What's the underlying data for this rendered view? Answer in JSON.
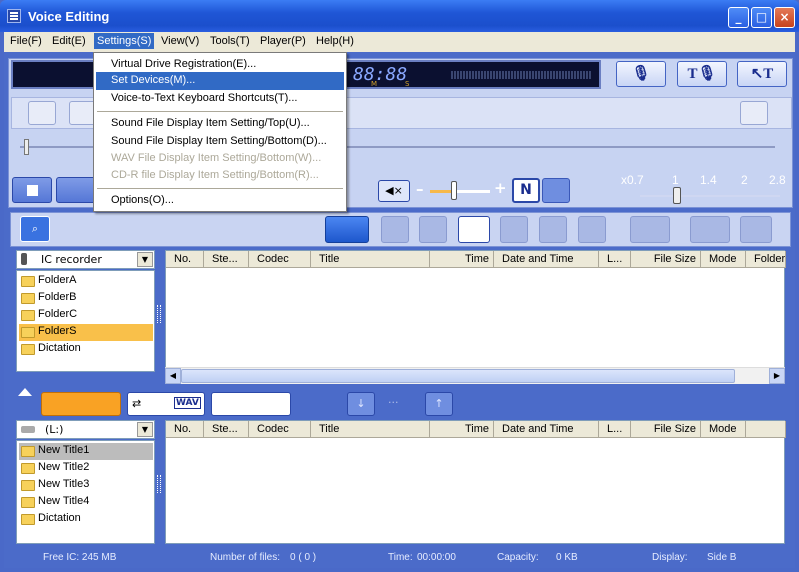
{
  "window": {
    "title": "Voice Editing"
  },
  "menubar": {
    "items": [
      "File(F)",
      "Edit(E)",
      "Settings(S)",
      "View(V)",
      "Tools(T)",
      "Player(P)",
      "Help(H)"
    ]
  },
  "settings_menu": {
    "group1": [
      "Virtual Drive Registration(E)...",
      "Set Devices(M)...",
      "Voice-to-Text Keyboard Shortcuts(T)..."
    ],
    "group2": [
      "Sound File Display Item Setting/Top(U)...",
      "Sound File Display Item Setting/Bottom(D)...",
      "WAV File Display Item Setting/Bottom(W)...",
      "CD-R file Display Item Setting/Bottom(R)..."
    ],
    "group3": [
      "Options(O)..."
    ],
    "highlighted": "Set Devices(M)...",
    "disabled": [
      "WAV File Display Item Setting/Bottom(W)...",
      "CD-R file Display Item Setting/Bottom(R)..."
    ]
  },
  "lcd": {
    "time": "88:88",
    "m_label": "M",
    "s_label": "S"
  },
  "speed": {
    "labels": [
      "x0.7",
      "1",
      "1.4",
      "2",
      "2.8"
    ]
  },
  "volume": {
    "minus": "–",
    "plus": "+"
  },
  "top_pane": {
    "device": "IC recorder",
    "folders": [
      "FolderA",
      "FolderB",
      "FolderC",
      "FolderS",
      "Dictation"
    ],
    "selected": "FolderS",
    "columns": [
      "No.",
      "Ste...",
      "Codec",
      "Title",
      "Time",
      "Date and Time",
      "L...",
      "File Size",
      "Mode",
      "Folder"
    ]
  },
  "bottom_pane": {
    "drive": "(L:)",
    "folders": [
      "New Title1",
      "New Title2",
      "New Title3",
      "New Title4",
      "Dictation"
    ],
    "selected": "New Title1",
    "columns": [
      "No.",
      "Ste...",
      "Codec",
      "Title",
      "Time",
      "Date and Time",
      "L...",
      "File Size",
      "Mode"
    ],
    "wav_label": "WAV"
  },
  "status": {
    "free_ic": "Free IC: 245 MB",
    "files_label": "Number of files:",
    "files_value": "0 ( 0 )",
    "time_label": "Time:",
    "time_value": "00:00:00",
    "capacity_label": "Capacity:",
    "capacity_value": "0 KB",
    "display_label": "Display:",
    "display_value": "Side B"
  },
  "colors": {
    "accent": "#316ac5",
    "frame": "#4b6bc9",
    "folder": "#f7d15a"
  }
}
